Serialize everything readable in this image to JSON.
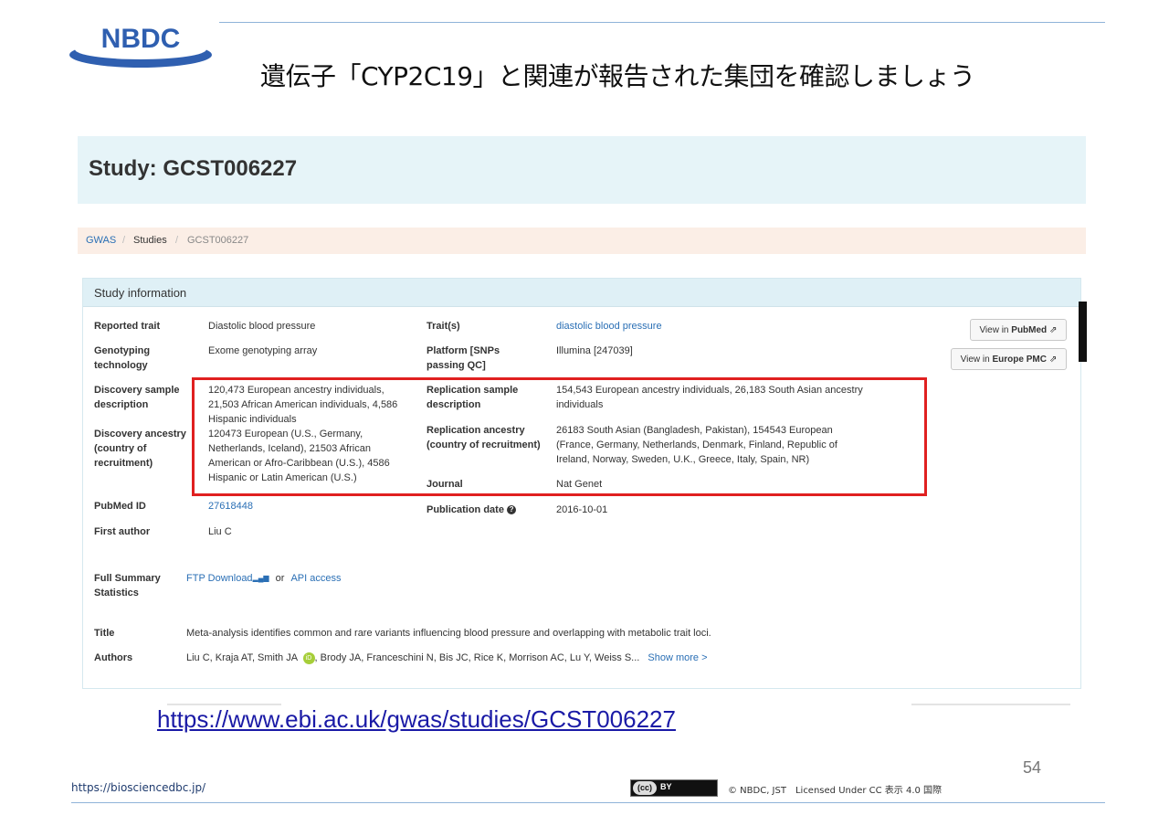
{
  "slide": {
    "logo_text": "NBDC",
    "title": "遺伝子「CYP2C19」と関連が報告された集団を確認しましょう",
    "url": "https://www.ebi.ac.uk/gwas/studies/GCST006227",
    "page_number": "54",
    "site": "https://biosciencedbc.jp/",
    "cc_badge": "(cc)",
    "cc_by": "BY",
    "license": "© NBDC, JST　Licensed Under CC 表示 4.0 国際"
  },
  "study": {
    "heading": "Study:  GCST006227"
  },
  "breadcrumb": {
    "items": [
      "GWAS",
      "Studies",
      "GCST006227"
    ],
    "separator": "/"
  },
  "panel": {
    "title": "Study information",
    "left": [
      {
        "label": "Reported trait",
        "value": "Diastolic blood pressure"
      },
      {
        "label": "Genotyping technology",
        "value": "Exome genotyping array"
      },
      {
        "label": "Discovery sample description",
        "value": "120,473 European ancestry individuals, 21,503 African American individuals, 4,586 Hispanic individuals"
      },
      {
        "label": "Discovery ancestry (country of recruitment)",
        "value": "120473 European (U.S., Germany, Netherlands, Iceland), 21503 African American or Afro-Caribbean (U.S.), 4586 Hispanic or Latin American (U.S.)"
      },
      {
        "label": "PubMed ID",
        "value": "27618448"
      },
      {
        "label": "First author",
        "value": "Liu C"
      }
    ],
    "right": [
      {
        "label": "Trait(s)",
        "value": "diastolic blood pressure"
      },
      {
        "label": "Platform [SNPs passing QC]",
        "value": "Illumina [247039]"
      },
      {
        "label": "Replication sample description",
        "value": "154,543 European ancestry individuals, 26,183 South Asian ancestry individuals"
      },
      {
        "label": "Replication ancestry (country of recruitment)",
        "value": "26183 South Asian (Bangladesh, Pakistan), 154543 European (France, Germany, Netherlands, Denmark, Finland, Republic of Ireland, Norway, Sweden, U.K., Greece, Italy, Spain, NR)"
      },
      {
        "label": "Journal",
        "value": "Nat Genet"
      },
      {
        "label": "Publication date",
        "value": "2016-10-01"
      }
    ],
    "summary_stats": {
      "label": "Full Summary Statistics",
      "ftp": "FTP Download",
      "or": "or",
      "api": "API access"
    },
    "title_row": {
      "label": "Title",
      "value": "Meta-analysis identifies common and rare variants influencing blood pressure and overlapping with metabolic trait loci."
    },
    "authors_row": {
      "label": "Authors",
      "value_a": "Liu C, Kraja AT, Smith JA",
      "orcid": "iD",
      "value_b": ", Brody JA, Franceschini N, Bis JC, Rice K, Morrison AC, Lu Y, Weiss S...",
      "show_more": "Show more >"
    },
    "buttons": {
      "pubmed_prefix": "View in ",
      "pubmed": "PubMed",
      "europepmc_prefix": "View in ",
      "europepmc": "Europe PMC",
      "ext_glyph": "⇗"
    }
  },
  "colors": {
    "link": "#2a6fb5",
    "highlight": "#e02020",
    "header_bg": "#e6f4f8",
    "breadcrumb_bg": "#fbeee6",
    "logo": "#2f5fb0"
  }
}
